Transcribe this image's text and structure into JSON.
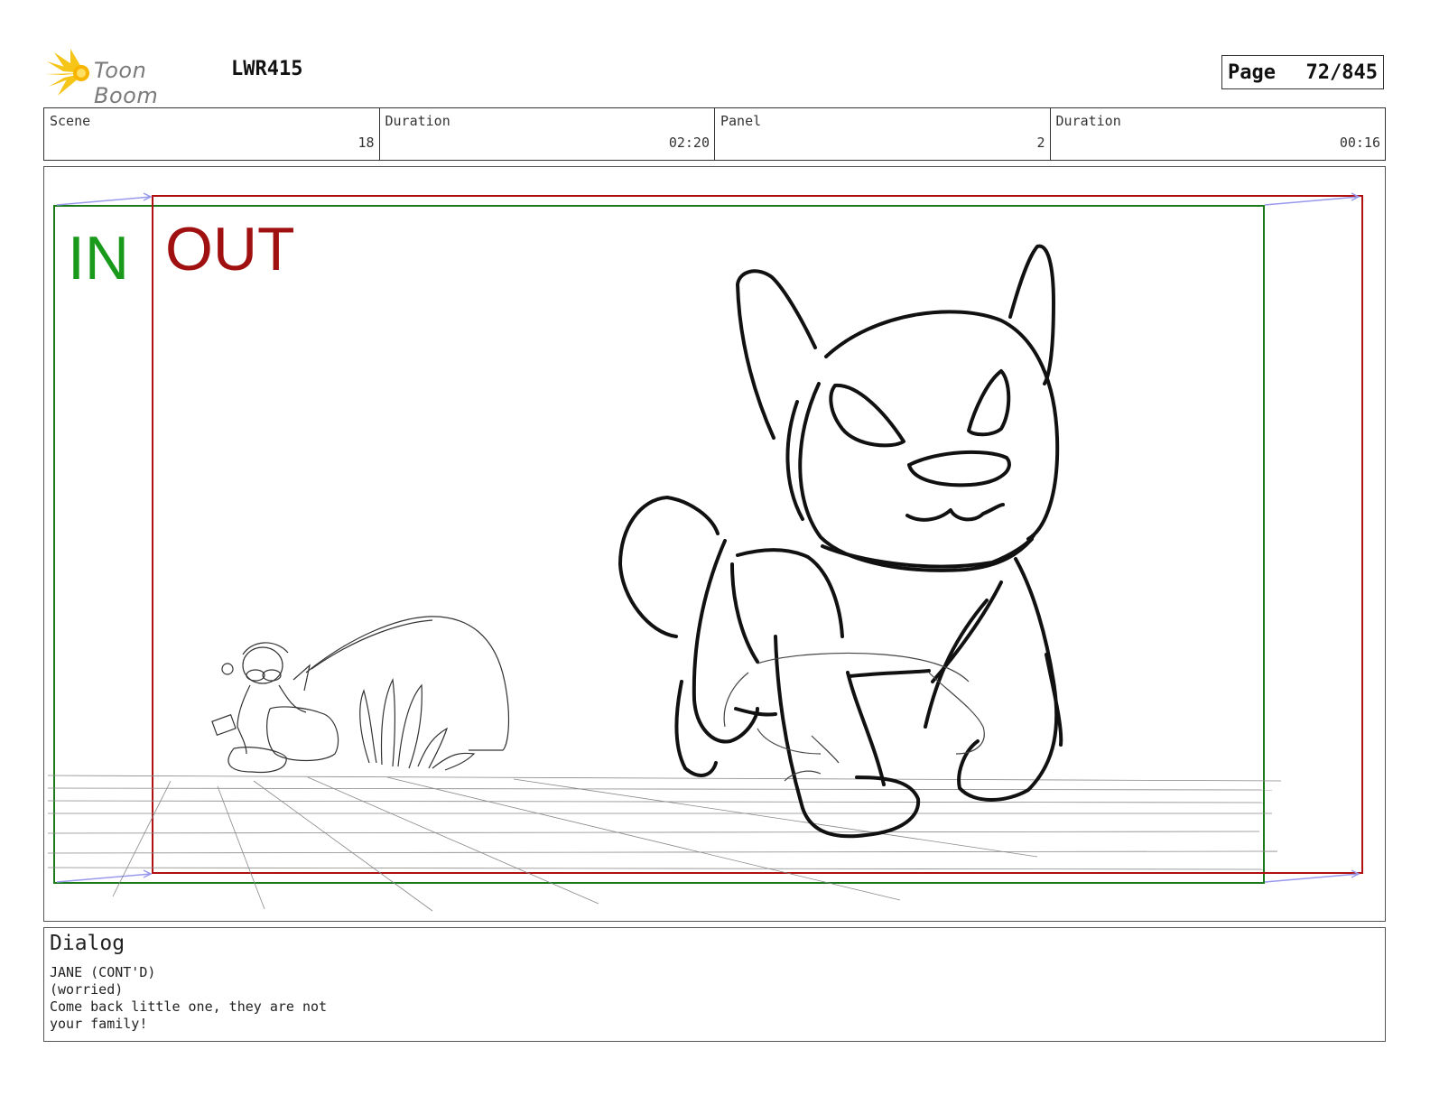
{
  "header": {
    "logo_text": "Toon Boom",
    "project_code": "LWR415",
    "page_label": "Page",
    "page_number": "72/845"
  },
  "info": {
    "scene_label": "Scene",
    "scene_value": "18",
    "scene_duration_label": "Duration",
    "scene_duration_value": "02:20",
    "panel_label": "Panel",
    "panel_value": "2",
    "panel_duration_label": "Duration",
    "panel_duration_value": "00:16"
  },
  "panel": {
    "in_label": "IN",
    "out_label": "OUT",
    "colors": {
      "in": "#1a9a1a",
      "out": "#a01010",
      "arrow": "#9999ee"
    }
  },
  "dialog": {
    "title": "Dialog",
    "lines": [
      "JANE (CONT'D)",
      "(worried)",
      "Come back little one, they are not",
      "your family!"
    ]
  }
}
